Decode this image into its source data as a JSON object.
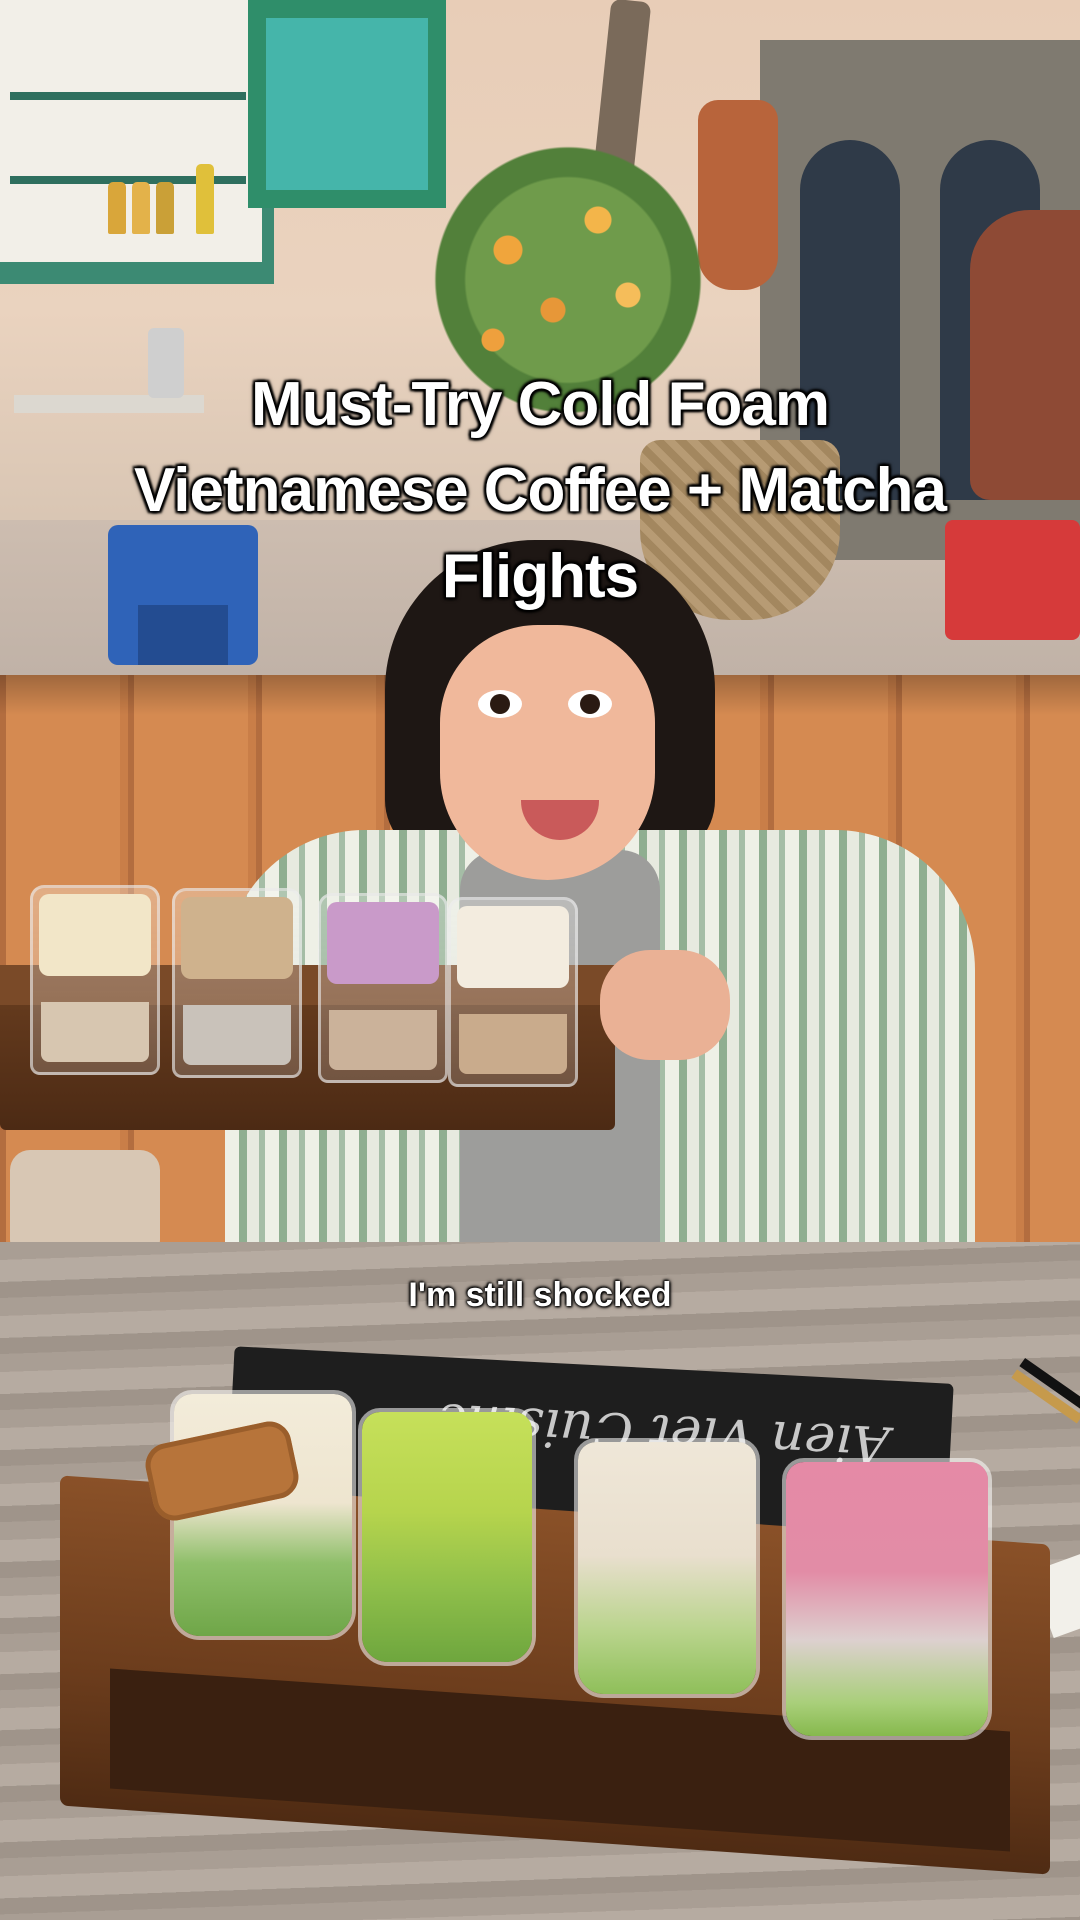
{
  "overlay": {
    "title_lines": [
      "Must-Try Cold Foam",
      "Vietnamese Coffee + Matcha",
      "Flights"
    ],
    "subtitle": "I'm still shocked"
  },
  "scene": {
    "chalkboard_text": "Aien Viet Cuisine",
    "colors": {
      "booth": "#d58a51",
      "table": "#b6aba1",
      "tray": "#6b3c1c",
      "matcha": "#8fbf4a",
      "pink_foam": "#e58aa6",
      "coffee_foam": "#f1ead9"
    }
  }
}
